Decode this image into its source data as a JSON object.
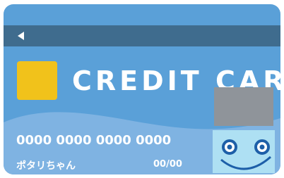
{
  "colors": {
    "card_blue": "#5aa0d8",
    "stripe": "#3f6c8e",
    "lower_band": "#7fb3e2",
    "chip": "#f1c21b",
    "signature_box": "#8f949a",
    "mascot_bg": "#aee0f3",
    "mascot_features": "#1d5fa8"
  },
  "icons": {
    "back": "left-triangle-arrow",
    "chip": "card-chip",
    "mascot": "smiling-face"
  },
  "card": {
    "brand": "CREDIT CARD",
    "number": "0000 0000 0000 0000",
    "holder_name": "ポタリちゃん",
    "expiry": "00/00"
  }
}
